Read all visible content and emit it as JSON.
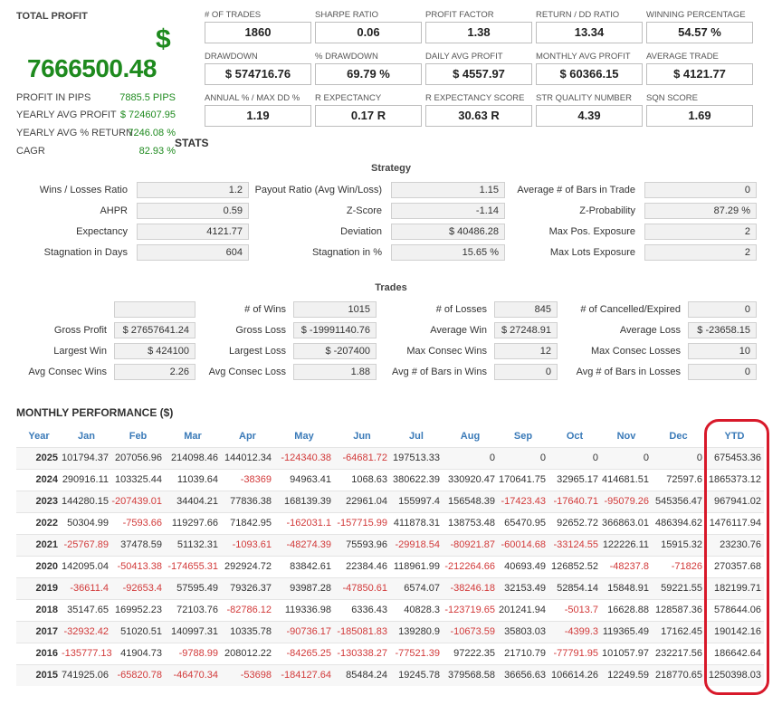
{
  "total_profit": {
    "label": "TOTAL PROFIT",
    "currency": "$",
    "value": "7666500.48"
  },
  "summary": [
    {
      "label": "PROFIT IN PIPS",
      "value": "7885.5 PIPS"
    },
    {
      "label": "YEARLY AVG PROFIT",
      "value": "$ 724607.95"
    },
    {
      "label": "YEARLY AVG % RETURN",
      "value": "7246.08 %"
    },
    {
      "label": "CAGR",
      "value": "82.93 %"
    }
  ],
  "metrics": [
    {
      "label": "# OF TRADES",
      "value": "1860"
    },
    {
      "label": "SHARPE RATIO",
      "value": "0.06"
    },
    {
      "label": "PROFIT FACTOR",
      "value": "1.38"
    },
    {
      "label": "RETURN / DD RATIO",
      "value": "13.34"
    },
    {
      "label": "WINNING PERCENTAGE",
      "value": "54.57 %"
    },
    {
      "label": "DRAWDOWN",
      "value": "$ 574716.76"
    },
    {
      "label": "% DRAWDOWN",
      "value": "69.79 %"
    },
    {
      "label": "DAILY AVG PROFIT",
      "value": "$ 4557.97"
    },
    {
      "label": "MONTHLY AVG PROFIT",
      "value": "$ 60366.15"
    },
    {
      "label": "AVERAGE TRADE",
      "value": "$ 4121.77"
    },
    {
      "label": "ANNUAL % / MAX DD %",
      "value": "1.19"
    },
    {
      "label": "R EXPECTANCY",
      "value": "0.17 R"
    },
    {
      "label": "R EXPECTANCY SCORE",
      "value": "30.63 R"
    },
    {
      "label": "STR QUALITY NUMBER",
      "value": "4.39"
    },
    {
      "label": "SQN SCORE",
      "value": "1.69"
    }
  ],
  "stats_title": "STATS",
  "strategy": {
    "title": "Strategy",
    "rows": [
      [
        {
          "label": "Wins / Losses Ratio",
          "value": "1.2"
        },
        {
          "label": "Payout Ratio (Avg Win/Loss)",
          "value": "1.15"
        },
        {
          "label": "Average # of Bars in Trade",
          "value": "0"
        }
      ],
      [
        {
          "label": "AHPR",
          "value": "0.59"
        },
        {
          "label": "Z-Score",
          "value": "-1.14"
        },
        {
          "label": "Z-Probability",
          "value": "87.29 %"
        }
      ],
      [
        {
          "label": "Expectancy",
          "value": "4121.77"
        },
        {
          "label": "Deviation",
          "value": "$ 40486.28"
        },
        {
          "label": "Max Pos. Exposure",
          "value": "2"
        }
      ],
      [
        {
          "label": "Stagnation in Days",
          "value": "604"
        },
        {
          "label": "Stagnation in %",
          "value": "15.65 %"
        },
        {
          "label": "Max Lots Exposure",
          "value": "2"
        }
      ]
    ]
  },
  "trades": {
    "title": "Trades",
    "rows": [
      [
        {
          "label": "",
          "value": ""
        },
        {
          "label": "# of Wins",
          "value": "1015"
        },
        {
          "label": "# of Losses",
          "value": "845"
        },
        {
          "label": "# of Cancelled/Expired",
          "value": "0"
        }
      ],
      [
        {
          "label": "Gross Profit",
          "value": "$ 27657641.24"
        },
        {
          "label": "Gross Loss",
          "value": "$ -19991140.76"
        },
        {
          "label": "Average Win",
          "value": "$ 27248.91"
        },
        {
          "label": "Average Loss",
          "value": "$ -23658.15"
        }
      ],
      [
        {
          "label": "Largest Win",
          "value": "$ 424100"
        },
        {
          "label": "Largest Loss",
          "value": "$ -207400"
        },
        {
          "label": "Max Consec Wins",
          "value": "12"
        },
        {
          "label": "Max Consec Losses",
          "value": "10"
        }
      ],
      [
        {
          "label": "Avg Consec Wins",
          "value": "2.26"
        },
        {
          "label": "Avg Consec Loss",
          "value": "1.88"
        },
        {
          "label": "Avg # of Bars in Wins",
          "value": "0"
        },
        {
          "label": "Avg # of Bars in Losses",
          "value": "0"
        }
      ]
    ]
  },
  "monthly": {
    "title": "MONTHLY PERFORMANCE ($)",
    "headers": [
      "Year",
      "Jan",
      "Feb",
      "Mar",
      "Apr",
      "May",
      "Jun",
      "Jul",
      "Aug",
      "Sep",
      "Oct",
      "Nov",
      "Dec",
      "YTD"
    ],
    "rows": [
      [
        "2025",
        "101794.37",
        "207056.96",
        "214098.46",
        "144012.34",
        "-124340.38",
        "-64681.72",
        "197513.33",
        "0",
        "0",
        "0",
        "0",
        "0",
        "675453.36"
      ],
      [
        "2024",
        "290916.11",
        "103325.44",
        "11039.64",
        "-38369",
        "94963.41",
        "1068.63",
        "380622.39",
        "330920.47",
        "170641.75",
        "32965.17",
        "414681.51",
        "72597.6",
        "1865373.12"
      ],
      [
        "2023",
        "144280.15",
        "-207439.01",
        "34404.21",
        "77836.38",
        "168139.39",
        "22961.04",
        "155997.4",
        "156548.39",
        "-17423.43",
        "-17640.71",
        "-95079.26",
        "545356.47",
        "967941.02"
      ],
      [
        "2022",
        "50304.99",
        "-7593.66",
        "119297.66",
        "71842.95",
        "-162031.1",
        "-157715.99",
        "411878.31",
        "138753.48",
        "65470.95",
        "92652.72",
        "366863.01",
        "486394.62",
        "1476117.94"
      ],
      [
        "2021",
        "-25767.89",
        "37478.59",
        "51132.31",
        "-1093.61",
        "-48274.39",
        "75593.96",
        "-29918.54",
        "-80921.87",
        "-60014.68",
        "-33124.55",
        "122226.11",
        "15915.32",
        "23230.76"
      ],
      [
        "2020",
        "142095.04",
        "-50413.38",
        "-174655.31",
        "292924.72",
        "83842.61",
        "22384.46",
        "118961.99",
        "-212264.66",
        "40693.49",
        "126852.52",
        "-48237.8",
        "-71826",
        "270357.68"
      ],
      [
        "2019",
        "-36611.4",
        "-92653.4",
        "57595.49",
        "79326.37",
        "93987.28",
        "-47850.61",
        "6574.07",
        "-38246.18",
        "32153.49",
        "52854.14",
        "15848.91",
        "59221.55",
        "182199.71"
      ],
      [
        "2018",
        "35147.65",
        "169952.23",
        "72103.76",
        "-82786.12",
        "119336.98",
        "6336.43",
        "40828.3",
        "-123719.65",
        "201241.94",
        "-5013.7",
        "16628.88",
        "128587.36",
        "578644.06"
      ],
      [
        "2017",
        "-32932.42",
        "51020.51",
        "140997.31",
        "10335.78",
        "-90736.17",
        "-185081.83",
        "139280.9",
        "-10673.59",
        "35803.03",
        "-4399.3",
        "119365.49",
        "17162.45",
        "190142.16"
      ],
      [
        "2016",
        "-135777.13",
        "41904.73",
        "-9788.99",
        "208012.22",
        "-84265.25",
        "-130338.27",
        "-77521.39",
        "97222.35",
        "21710.79",
        "-77791.95",
        "101057.97",
        "232217.56",
        "186642.64"
      ],
      [
        "2015",
        "741925.06",
        "-65820.78",
        "-46470.34",
        "-53698",
        "-184127.64",
        "85484.24",
        "19245.78",
        "379568.58",
        "36656.63",
        "106614.26",
        "12249.59",
        "218770.65",
        "1250398.03"
      ]
    ]
  },
  "colors": {
    "profit_green": "#1e8a1e",
    "negative_red": "#d23a3a",
    "header_blue": "#3a7ab8",
    "highlight_red": "#d8192a"
  }
}
